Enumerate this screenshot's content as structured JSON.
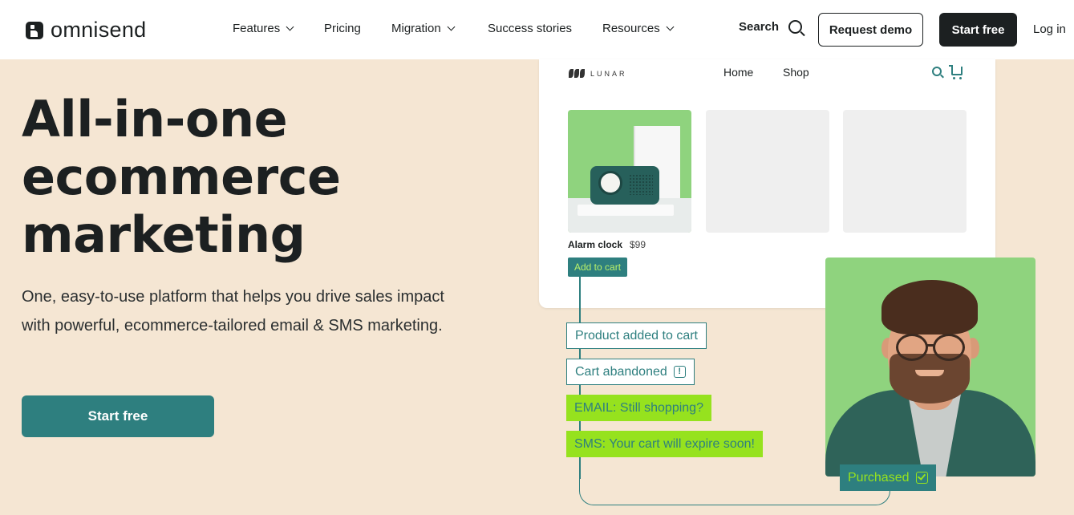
{
  "header": {
    "logo_text": "omnisend",
    "nav": [
      {
        "label": "Features",
        "dropdown": true
      },
      {
        "label": "Pricing",
        "dropdown": false
      },
      {
        "label": "Migration",
        "dropdown": true
      },
      {
        "label": "Success stories",
        "dropdown": false
      },
      {
        "label": "Resources",
        "dropdown": true
      }
    ],
    "search_label": "Search",
    "request_demo": "Request demo",
    "start_free": "Start free",
    "login": "Log in"
  },
  "hero": {
    "title_lines": [
      "All-in-one",
      "ecommerce",
      "marketing"
    ],
    "subtitle": "One, easy-to-use platform that helps you drive sales impact with powerful, ecommerce-tailored email & SMS marketing.",
    "cta": "Start free"
  },
  "shop": {
    "brand": "LUNAR",
    "nav": [
      "Home",
      "Shop"
    ],
    "product_name": "Alarm clock",
    "product_price": "$99",
    "add_to_cart": "Add to cart"
  },
  "flow": {
    "steps": [
      {
        "label": "Product added to cart",
        "style": "outline"
      },
      {
        "label": "Cart abandoned",
        "style": "outline",
        "icon": "alert-icon"
      },
      {
        "label": "EMAIL: Still shopping?",
        "style": "green"
      },
      {
        "label": "SMS: Your cart will expire soon!",
        "style": "green"
      }
    ],
    "final": "Purchased"
  },
  "colors": {
    "background": "#f5e6d3",
    "accent_teal": "#2e7f7f",
    "accent_lime": "#96e21e",
    "dark": "#1c2021"
  }
}
